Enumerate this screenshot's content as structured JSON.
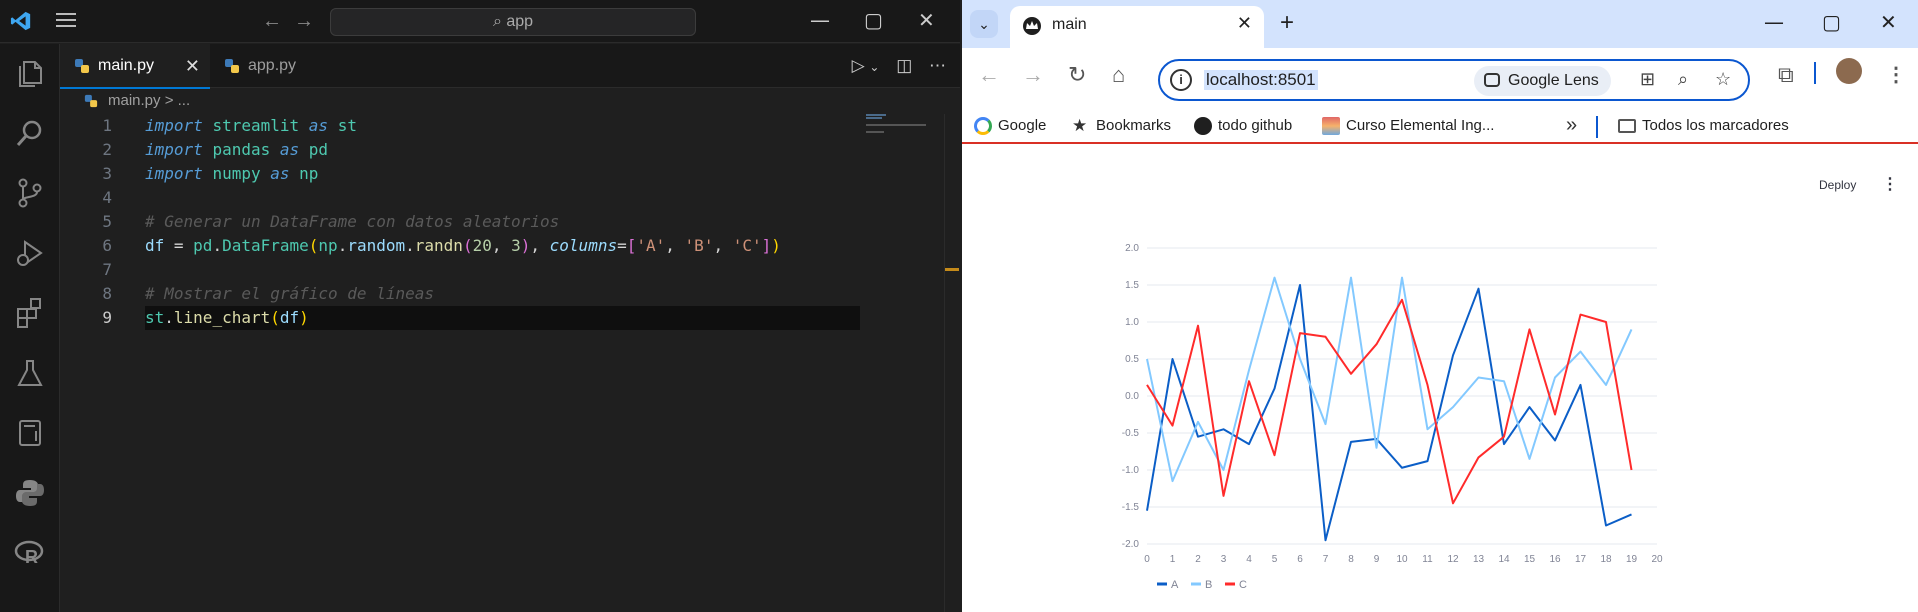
{
  "vscode": {
    "search": "app",
    "tabs": [
      {
        "label": "main.py",
        "active": true
      },
      {
        "label": "app.py",
        "active": false
      }
    ],
    "breadcrumb": {
      "file": "main.py",
      "rest": "> ..."
    },
    "line_numbers": [
      "1",
      "2",
      "3",
      "4",
      "5",
      "6",
      "7",
      "8",
      "9"
    ]
  },
  "browser": {
    "tab_title": "main",
    "url": "localhost:8501",
    "lens_label": "Google Lens",
    "bookmarks": [
      "Google",
      "Bookmarks",
      "todo github",
      "Curso Elemental Ing...",
      "Todos los marcadores"
    ],
    "overflow": "»",
    "deploy_label": "Deploy",
    "colors": {
      "accent": "#0b57d0",
      "loading_bar": "#d93025"
    }
  },
  "chart_data": {
    "type": "line",
    "x": [
      0,
      1,
      2,
      3,
      4,
      5,
      6,
      7,
      8,
      9,
      10,
      11,
      12,
      13,
      14,
      15,
      16,
      17,
      18,
      19
    ],
    "x_ticks": [
      "0",
      "1",
      "2",
      "3",
      "4",
      "5",
      "6",
      "7",
      "8",
      "9",
      "10",
      "11",
      "12",
      "13",
      "14",
      "15",
      "16",
      "17",
      "18",
      "19",
      "20"
    ],
    "y_ticks": [
      "2.0",
      "1.5",
      "1.0",
      "0.5",
      "0.0",
      "-0.5",
      "-1.0",
      "-1.5",
      "-2.0"
    ],
    "xlim": [
      0,
      20
    ],
    "ylim": [
      -2.0,
      2.0
    ],
    "grid": "horizontal",
    "legend_placement": "bottom-left",
    "series": [
      {
        "name": "A",
        "color": "#0b5ec7",
        "values": [
          -1.55,
          0.5,
          -0.55,
          -0.45,
          -0.65,
          0.1,
          1.5,
          -1.95,
          -0.62,
          -0.58,
          -0.97,
          -0.88,
          0.55,
          1.45,
          -0.65,
          -0.15,
          -0.6,
          0.15,
          -1.75,
          -1.6
        ]
      },
      {
        "name": "B",
        "color": "#83c9ff",
        "values": [
          0.5,
          -1.15,
          -0.35,
          -1.0,
          0.35,
          1.6,
          0.5,
          -0.38,
          1.6,
          -0.7,
          1.6,
          -0.45,
          -0.15,
          0.25,
          0.2,
          -0.85,
          0.25,
          0.6,
          0.15,
          0.9
        ]
      },
      {
        "name": "C",
        "color": "#ff2b2b",
        "values": [
          0.15,
          -0.4,
          0.95,
          -1.35,
          0.2,
          -0.8,
          0.85,
          0.8,
          0.3,
          0.7,
          1.3,
          0.15,
          -1.45,
          -0.83,
          -0.55,
          0.9,
          -0.25,
          1.1,
          1.0,
          -1.0
        ]
      }
    ]
  }
}
